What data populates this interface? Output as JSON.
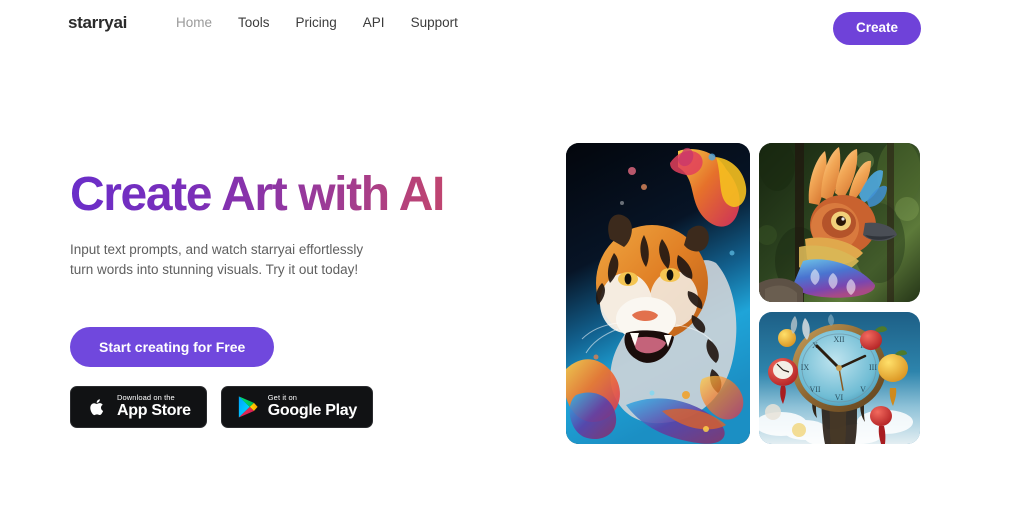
{
  "header": {
    "logo": "starryai",
    "nav": [
      {
        "label": "Home",
        "state": "muted"
      },
      {
        "label": "Tools",
        "state": "normal"
      },
      {
        "label": "Pricing",
        "state": "normal"
      },
      {
        "label": "API",
        "state": "normal"
      },
      {
        "label": "Support",
        "state": "normal"
      }
    ],
    "create_label": "Create",
    "create_color": "#6f42d9"
  },
  "hero": {
    "title": "Create Art with AI",
    "title_gradient_from": "#6a2ec9",
    "title_gradient_to": "#c9496a",
    "subtitle_line1": "Input text prompts, and watch starryai effortlessly",
    "subtitle_line2": "turn words into stunning visuals. Try it out today!",
    "cta_label": "Start creating for Free",
    "cta_color": "#7048dd"
  },
  "store_badges": [
    {
      "icon": "apple-logo-icon",
      "small": "Download on the",
      "big": "App Store"
    },
    {
      "icon": "google-play-icon",
      "small": "Get it on",
      "big": "Google Play"
    }
  ],
  "gallery": {
    "items": [
      {
        "name": "tiger-paint-splash-artwork",
        "alt": "Roaring tiger with colorful paint splash on dark blue background"
      },
      {
        "name": "colorful-bird-artwork",
        "alt": "Crested bird with orange and blue feathers in a forest"
      },
      {
        "name": "surreal-clock-artwork",
        "alt": "Surreal melting clock with floating apples in a blue sky"
      }
    ]
  }
}
